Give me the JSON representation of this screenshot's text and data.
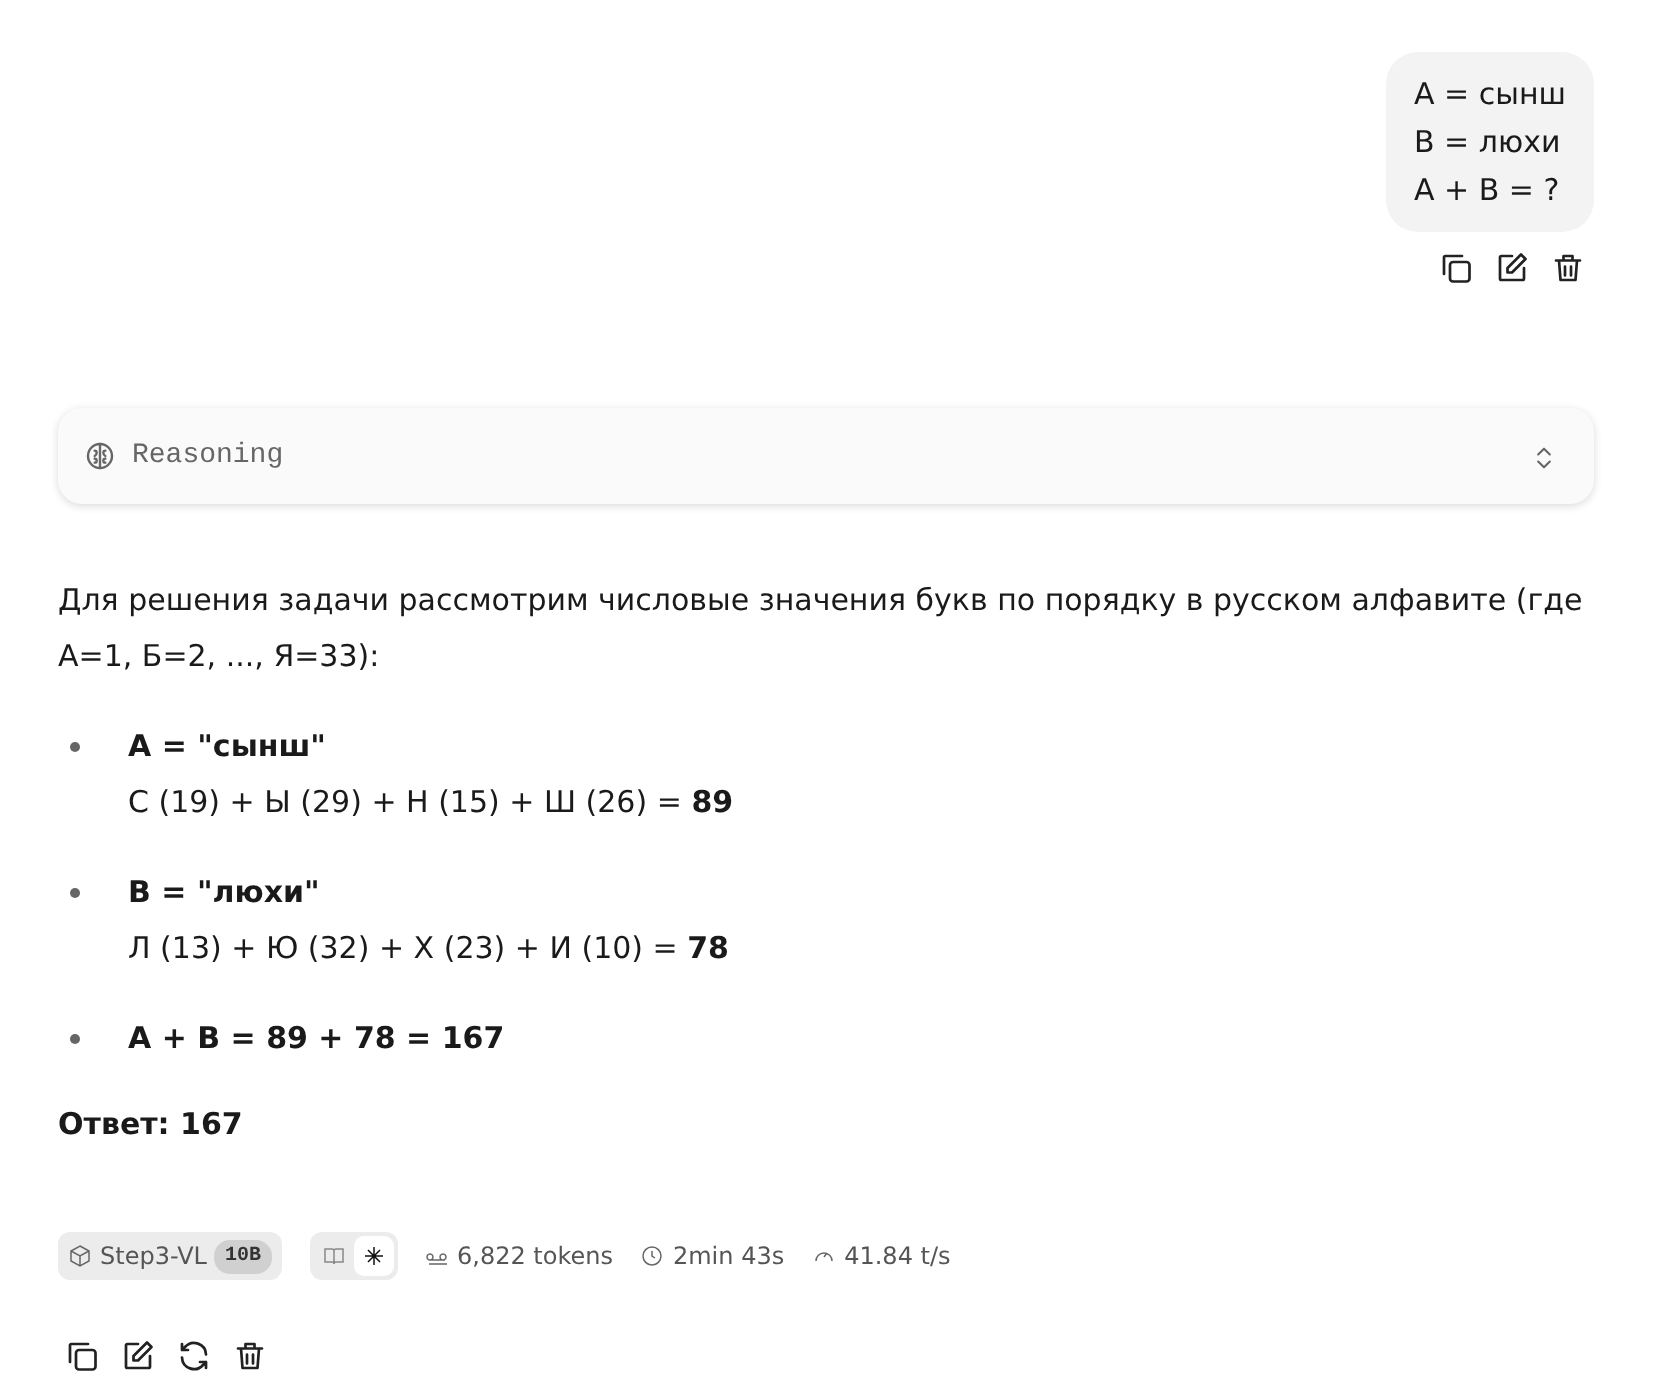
{
  "user_message": {
    "lines": [
      "A = сынш",
      "B = люхи",
      "A + B = ?"
    ]
  },
  "reasoning": {
    "label": "Reasoning",
    "expanded": false
  },
  "answer": {
    "intro": "Для решения задачи рассмотрим числовые значения букв по порядку в русском алфавите (где А=1, Б=2, ..., Я=33):",
    "items": [
      {
        "title": "A = \"сынш\"",
        "detail": "С (19) + Ы (29) + Н (15) + Ш (26) = **89**"
      },
      {
        "title": "B = \"люхи\"",
        "detail": "Л (13) + Ю (32) + Х (23) + И (10) = **78**"
      },
      {
        "title": "A + B = 89 + 78 = 167"
      }
    ],
    "result": "Ответ: 167"
  },
  "meta": {
    "model": "Step3-VL",
    "model_badge": "10B",
    "modes": [
      {
        "kind": "book",
        "selected": false
      },
      {
        "kind": "sparkle",
        "selected": true
      }
    ],
    "tokens": "6,822 tokens",
    "time": "2min 43s",
    "speed": "41.84 t/s"
  }
}
